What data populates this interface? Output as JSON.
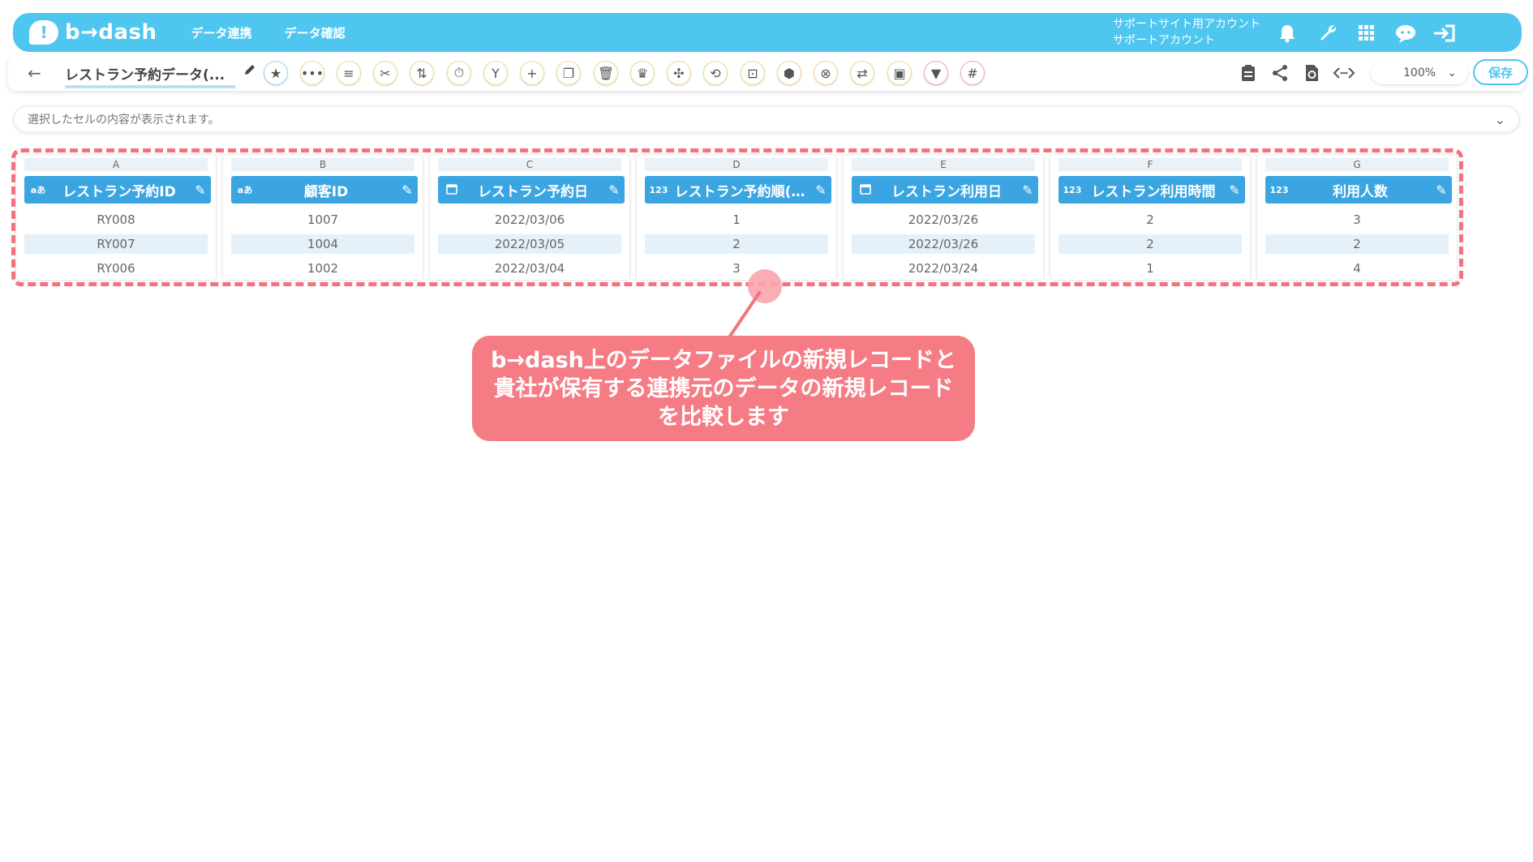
{
  "header": {
    "logo_text": "b→dash",
    "nav": [
      "データ連携",
      "データ確認"
    ],
    "account_line1": "サポートサイト用アカウント",
    "account_line2": "サポートアカウント"
  },
  "toolbar": {
    "back_icon": "arrow-left-icon",
    "file_title": "レストラン予約データ(...",
    "zoom": "100%",
    "save_label": "保存"
  },
  "cellbar": {
    "placeholder": "選択したセルの内容が表示されます。"
  },
  "columns": [
    {
      "letter": "A",
      "type": "aあ",
      "name": "レストラン予約ID",
      "cells": [
        "RY008",
        "RY007",
        "RY006"
      ]
    },
    {
      "letter": "B",
      "type": "aあ",
      "name": "顧客ID",
      "cells": [
        "1007",
        "1004",
        "1002"
      ]
    },
    {
      "letter": "C",
      "type": "calendar",
      "name": "レストラン予約日",
      "cells": [
        "2022/03/06",
        "2022/03/05",
        "2022/03/04"
      ]
    },
    {
      "letter": "D",
      "type": "123",
      "name": "レストラン予約順(…",
      "cells": [
        "1",
        "2",
        "3"
      ]
    },
    {
      "letter": "E",
      "type": "calendar",
      "name": "レストラン利用日",
      "cells": [
        "2022/03/26",
        "2022/03/26",
        "2022/03/24"
      ]
    },
    {
      "letter": "F",
      "type": "123",
      "name": "レストラン利用時間",
      "cells": [
        "2",
        "2",
        "1"
      ]
    },
    {
      "letter": "G",
      "type": "123",
      "name": "利用人数",
      "cells": [
        "3",
        "2",
        "4"
      ]
    }
  ],
  "callout": {
    "line1": "b→dash上のデータファイルの新規レコードと",
    "line2": "貴社が保有する連携元のデータの新規レコード",
    "line3": "を比較します"
  },
  "colors": {
    "header_bg": "#4fc6ef",
    "column_header": "#3ba5e2",
    "highlight": "#f2737d",
    "callout_bg": "#f57c85"
  }
}
